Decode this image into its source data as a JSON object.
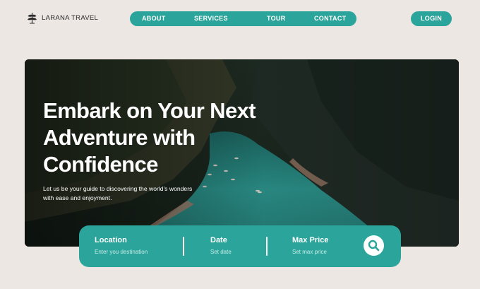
{
  "brand": {
    "name": "LARANA TRAVEL",
    "logo_icon": "leaf-icon"
  },
  "nav": {
    "items": [
      {
        "label": "ABOUT"
      },
      {
        "label": "SERVICES"
      },
      {
        "label": "TOUR"
      },
      {
        "label": "CONTACT"
      }
    ],
    "login_label": "LOGIN"
  },
  "hero": {
    "headline_lines": [
      "Embark on Your Next",
      "Adventure with",
      "Confidence"
    ],
    "subtext_lines": [
      "Let us be your guide to discovering the world's wonders",
      "with ease and enjoyment."
    ]
  },
  "search": {
    "fields": [
      {
        "label": "Location",
        "placeholder": "Enter you destination"
      },
      {
        "label": "Date",
        "placeholder": "Set date"
      },
      {
        "label": "Max Price",
        "placeholder": "Set max price"
      }
    ],
    "button_icon": "search-icon"
  },
  "colors": {
    "accent": "#2ba59b",
    "background": "#ede7e3",
    "text_dark": "#2b2b2b",
    "water": "#2e9f98"
  }
}
